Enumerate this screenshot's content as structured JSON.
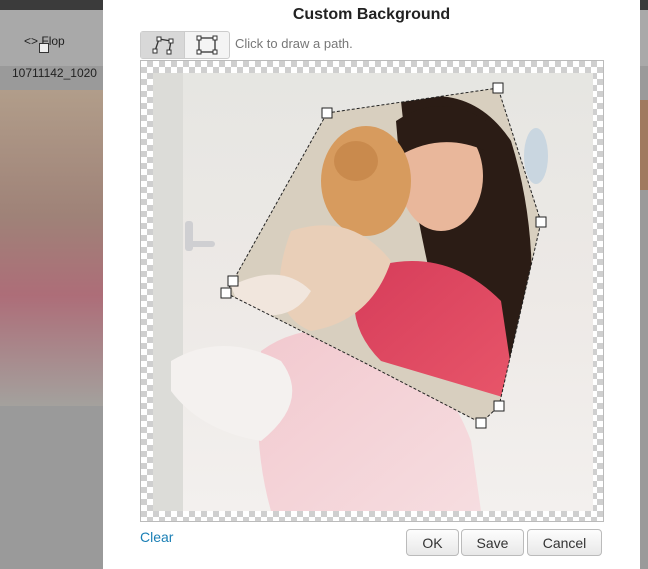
{
  "background": {
    "flop_label": "Flop",
    "filename": "10711142_1020"
  },
  "dialog": {
    "title": "Custom Background",
    "hint": "Click to draw a path.",
    "tools": [
      {
        "name": "path-tool",
        "active": true
      },
      {
        "name": "rectangle-tool",
        "active": false
      }
    ],
    "clear_label": "Clear",
    "buttons": {
      "ok": "OK",
      "save": "Save",
      "cancel": "Cancel"
    }
  },
  "colors": {
    "link": "#1a7fb5",
    "handle_fill": "#ffffff",
    "path_stroke": "#222222"
  },
  "icons": [
    "flop-icon",
    "path-tool-icon",
    "rectangle-tool-icon"
  ]
}
